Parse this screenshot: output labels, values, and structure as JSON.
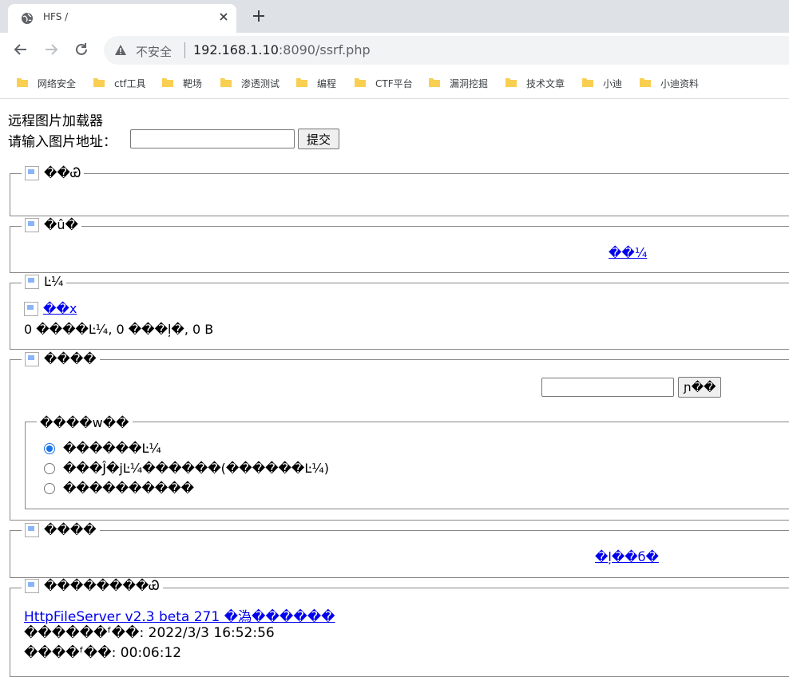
{
  "browser": {
    "tab_title": "HFS /",
    "not_secure": "不安全",
    "url_host": "192.168.1.10",
    "url_rest": ":8090/ssrf.php",
    "bookmarks": [
      "网络安全",
      "ctf工具",
      "靶场",
      "渗透测试",
      "编程",
      "CTF平台",
      "漏洞挖掘",
      "技术文章",
      "小迪",
      "小迪资料"
    ]
  },
  "form": {
    "heading": "远程图片加载器",
    "label": "请输入图片地址：",
    "input_value": "",
    "submit": "提交"
  },
  "sections": {
    "user_legend": "��Ꮿ",
    "login_legend": "�û�",
    "login_link": "��¼",
    "folder_legend": "Ŀ¼",
    "folder_link": "��x",
    "folder_stats": "0 ����Ŀ¼, 0 ���ļ�, 0 B",
    "search_legend": "����",
    "search_input": "",
    "search_button": "ɲ��",
    "options_legend": "����w��",
    "options": [
      "������Ŀ¼",
      "���Ĵ�jĿ¼������(������Ŀ¼)",
      "����������"
    ],
    "select_legend": "����",
    "select_link": "�ļ��б�",
    "server_legend": "��������Ꮿ",
    "server_link": "HttpFileServer v2.3 beta 271 �溈������",
    "server_time": "������ᶠ��: 2022/3/3 16:52:56",
    "server_uptime": "����ᶠ��: 00:06:12"
  }
}
